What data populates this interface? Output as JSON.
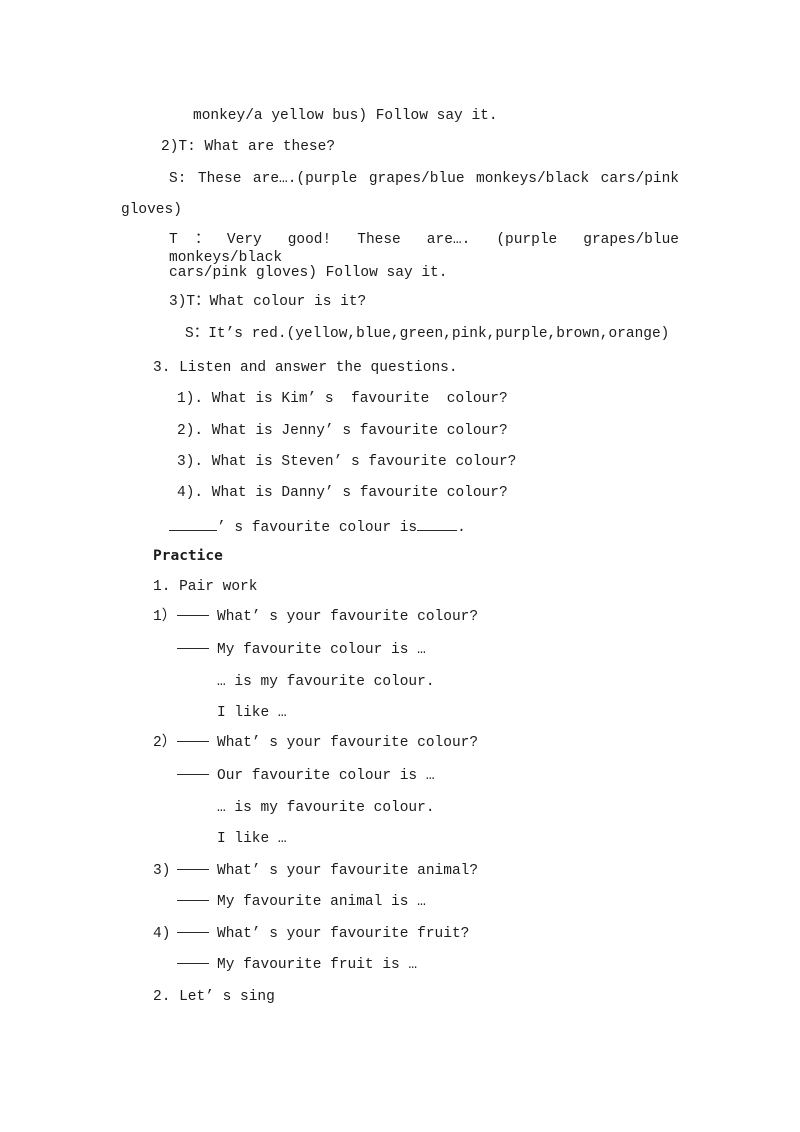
{
  "document": {
    "lines": {
      "l1": "monkey/a yellow bus) Follow say it.",
      "l2": "2)T: What are these?",
      "l3": "S:  These  are….(purple  grapes/blue  monkeys/black  cars/pink",
      "l4": "gloves)",
      "l5": "T：Very  good! These  are….  (purple  grapes/blue  monkeys/black",
      "l6": "cars/pink gloves) Follow say it.",
      "l7": "3)T：What colour is it?",
      "l8": "S：It’s red.(yellow,blue,green,pink,purple,brown,orange)"
    },
    "section3": {
      "heading": "3. Listen and answer the questions.",
      "questions": [
        "1). What is Kim’ s  favourite  colour?",
        "2). What is Jenny’ s favourite colour?",
        "3). What is Steven’ s favourite colour?",
        "4). What is Danny’ s favourite colour?"
      ],
      "answer_template": {
        "part1": "’ s favourite colour is",
        "part2": "."
      }
    },
    "practice": {
      "heading": "Practice",
      "item1_title": "1. Pair work",
      "dialogs": [
        {
          "num": "1）",
          "question": "What’ s your favourite colour?",
          "answer": "My favourite colour is …",
          "extra": [
            "… is my favourite colour.",
            "I like …"
          ]
        },
        {
          "num": "2）",
          "question": "What’ s your favourite colour?",
          "answer": "Our favourite colour is …",
          "extra": [
            "… is my favourite colour.",
            "I like …"
          ]
        },
        {
          "num": "3)",
          "question": "What’ s your favourite animal?",
          "answer": "My favourite animal is …",
          "extra": []
        },
        {
          "num": "4)",
          "question": "What’ s your favourite fruit?",
          "answer": "My favourite fruit is …",
          "extra": []
        }
      ],
      "item2_title": "2. Let’ s sing"
    }
  }
}
